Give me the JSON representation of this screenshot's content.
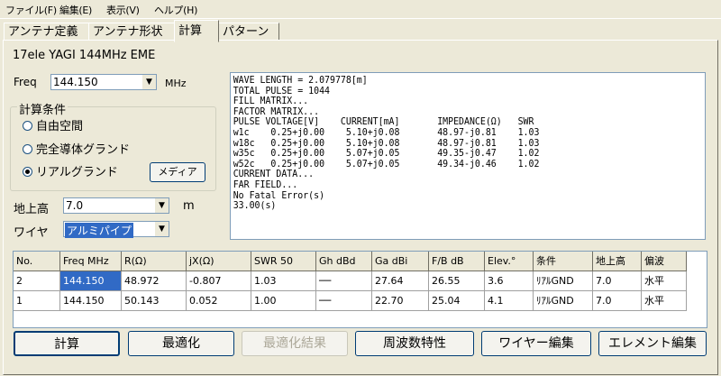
{
  "menu": [
    {
      "label": "ファイル(F)"
    },
    {
      "label": "編集(E)"
    },
    {
      "label": "表示(V)"
    },
    {
      "label": "ヘルプ(H)"
    }
  ],
  "tabs": [
    {
      "label": "アンテナ定義"
    },
    {
      "label": "アンテナ形状"
    },
    {
      "label": "計算"
    },
    {
      "label": "パターン"
    }
  ],
  "antenna_title": "17ele YAGI 144MHz EME",
  "freq": {
    "label": "Freq",
    "value": "144.150",
    "unit": "MHz"
  },
  "calc_conditions": {
    "title": "計算条件",
    "options": [
      {
        "label": "自由空間",
        "selected": false
      },
      {
        "label": "完全導体グランド",
        "selected": false
      },
      {
        "label": "リアルグランド",
        "selected": true
      }
    ],
    "media_button": "メディア"
  },
  "height": {
    "label": "地上高",
    "value": "7.0",
    "unit": "m"
  },
  "wire": {
    "label": "ワイヤ",
    "value": "アルミパイプ"
  },
  "output_lines": [
    "WAVE LENGTH = 2.079778[m]",
    "TOTAL PULSE = 1044",
    "FILL MATRIX...",
    "FACTOR MATRIX...",
    "PULSE VOLTAGE[V]    CURRENT[mA]       IMPEDANCE(Ω)   SWR",
    "w1c    0.25+j0.00    5.10+j0.08       48.97-j0.81    1.03",
    "w18c   0.25+j0.00    5.10+j0.08       48.97-j0.81    1.03",
    "w35c   0.25+j0.00    5.07+j0.05       49.35-j0.47    1.02",
    "w52c   0.25+j0.00    5.07+j0.05       49.34-j0.46    1.02",
    "CURRENT DATA...",
    "FAR FIELD...",
    "No Fatal Error(s)",
    "33.00(s)"
  ],
  "table": {
    "columns": [
      "No.",
      "Freq MHz",
      "R(Ω)",
      "jX(Ω)",
      "SWR 50",
      "Gh dBd",
      "Ga dBi",
      "F/B dB",
      "Elev.°",
      "条件",
      "地上高",
      "偏波"
    ],
    "rows": [
      [
        "2",
        "144.150",
        "48.972",
        "-0.807",
        "1.03",
        "──",
        "27.64",
        "26.55",
        "3.6",
        "ﾘｱﾙGND",
        "7.0",
        "水平"
      ],
      [
        "1",
        "144.150",
        "50.143",
        "0.052",
        "1.00",
        "──",
        "22.70",
        "25.04",
        "4.1",
        "ﾘｱﾙGND",
        "7.0",
        "水平"
      ]
    ]
  },
  "buttons": [
    {
      "label": "計算",
      "enabled": true
    },
    {
      "label": "最適化",
      "enabled": true
    },
    {
      "label": "最適化結果",
      "enabled": false
    },
    {
      "label": "周波数特性",
      "enabled": true
    },
    {
      "label": "ワイヤー編集",
      "enabled": true
    },
    {
      "label": "エレメント編集",
      "enabled": true
    }
  ]
}
